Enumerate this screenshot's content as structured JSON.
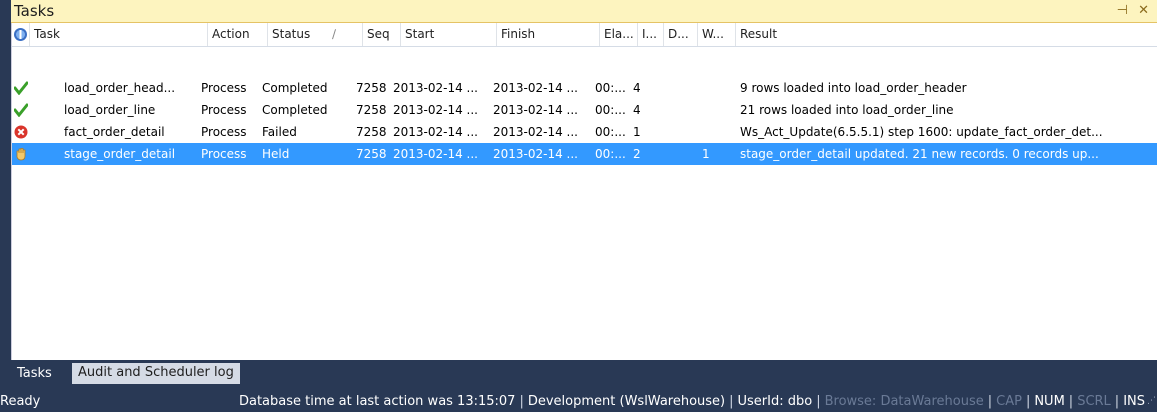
{
  "panel": {
    "title": "Tasks",
    "pin_glyph": "⊣",
    "close_glyph": "✕"
  },
  "columns": [
    {
      "key": "icon",
      "label": ""
    },
    {
      "key": "task",
      "label": "Task"
    },
    {
      "key": "action",
      "label": "Action"
    },
    {
      "key": "status",
      "label": "Status"
    },
    {
      "key": "seq",
      "label": "Seq"
    },
    {
      "key": "start",
      "label": "Start"
    },
    {
      "key": "finish",
      "label": "Finish"
    },
    {
      "key": "elapsed",
      "label": "Ela..."
    },
    {
      "key": "i",
      "label": "I..."
    },
    {
      "key": "d",
      "label": "D..."
    },
    {
      "key": "w",
      "label": "W..."
    },
    {
      "key": "result",
      "label": "Result"
    }
  ],
  "sort_indicator": "∕",
  "rows": [
    {
      "icon": "check-icon",
      "task": "load_order_head...",
      "action": "Process",
      "status": "Completed",
      "seq": "7258",
      "start": "2013-02-14 ...",
      "finish": "2013-02-14 ...",
      "elapsed": "00:...",
      "i": "4",
      "d": "",
      "w": "",
      "result": "9 rows loaded into load_order_header",
      "selected": false
    },
    {
      "icon": "check-icon",
      "task": "load_order_line",
      "action": "Process",
      "status": "Completed",
      "seq": "7258",
      "start": "2013-02-14 ...",
      "finish": "2013-02-14 ...",
      "elapsed": "00:...",
      "i": "4",
      "d": "",
      "w": "",
      "result": "21 rows loaded into load_order_line",
      "selected": false
    },
    {
      "icon": "error-icon",
      "task": "fact_order_detail",
      "action": "Process",
      "status": "Failed",
      "seq": "7258",
      "start": "2013-02-14 ...",
      "finish": "2013-02-14 ...",
      "elapsed": "00:...",
      "i": "1",
      "d": "",
      "w": "",
      "result": "Ws_Act_Update(6.5.5.1) step 1600: update_fact_order_det...",
      "selected": false
    },
    {
      "icon": "hand-icon",
      "task": "stage_order_detail",
      "action": "Process",
      "status": "Held",
      "seq": "7258",
      "start": "2013-02-14 ...",
      "finish": "2013-02-14 ...",
      "elapsed": "00:...",
      "i": "2",
      "d": "",
      "w": "1",
      "result": "stage_order_detail updated. 21 new records. 0 records up...",
      "selected": true
    }
  ],
  "tabs": [
    {
      "label": "Tasks",
      "active": false
    },
    {
      "label": "Audit and Scheduler log",
      "active": true
    }
  ],
  "status": {
    "ready": "Ready",
    "db_time": "Database time at last action was 13:15:07",
    "connection": "Development (WslWarehouse)",
    "user": "UserId: dbo",
    "browse": "Browse: DataWarehouse",
    "cap": "CAP",
    "num": "NUM",
    "scrl": "SCRL",
    "ins": "INS"
  },
  "colors": {
    "selected_row": "#3399ff",
    "title_bg": "#fdf4bf",
    "chrome": "#293955"
  }
}
